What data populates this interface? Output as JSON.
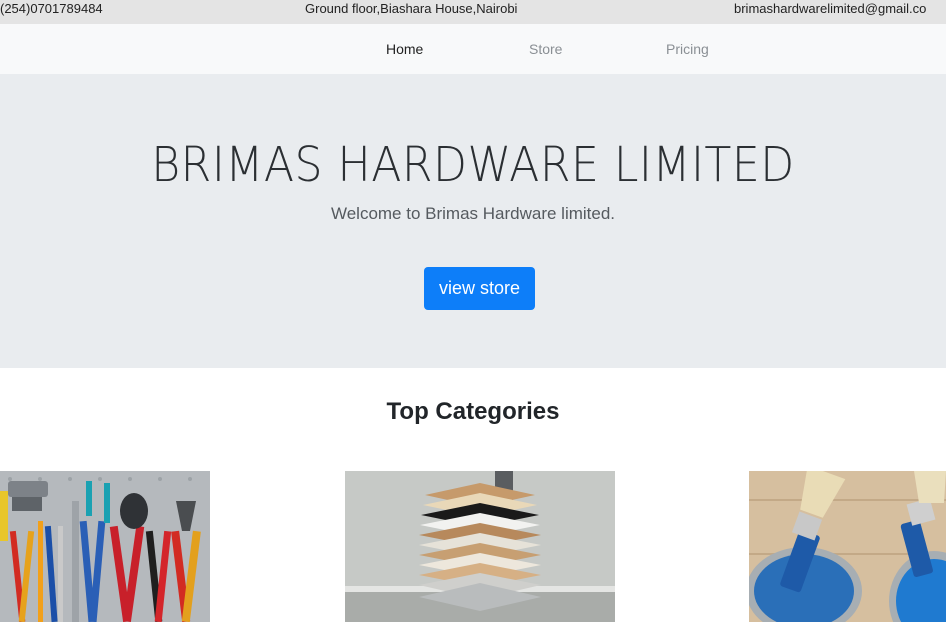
{
  "topbar": {
    "phone": "(254)0701789484",
    "address": "Ground floor,Biashara House,Nairobi",
    "email": "brimashardwarelimited@gmail.co"
  },
  "nav": {
    "items": [
      {
        "label": "Home"
      },
      {
        "label": "Store"
      },
      {
        "label": "Pricing"
      }
    ]
  },
  "hero": {
    "title": "BRIMAS HARDWARE LIMITED",
    "subtitle": "Welcome to Brimas Hardware limited.",
    "button_label": "view store"
  },
  "categories": {
    "heading": "Top Categories"
  },
  "colors": {
    "primary": "#0d7ef9",
    "hero_bg": "#e9ecef",
    "navbar_bg": "#f8f9fa",
    "topbar_bg": "#e4e4e4"
  }
}
